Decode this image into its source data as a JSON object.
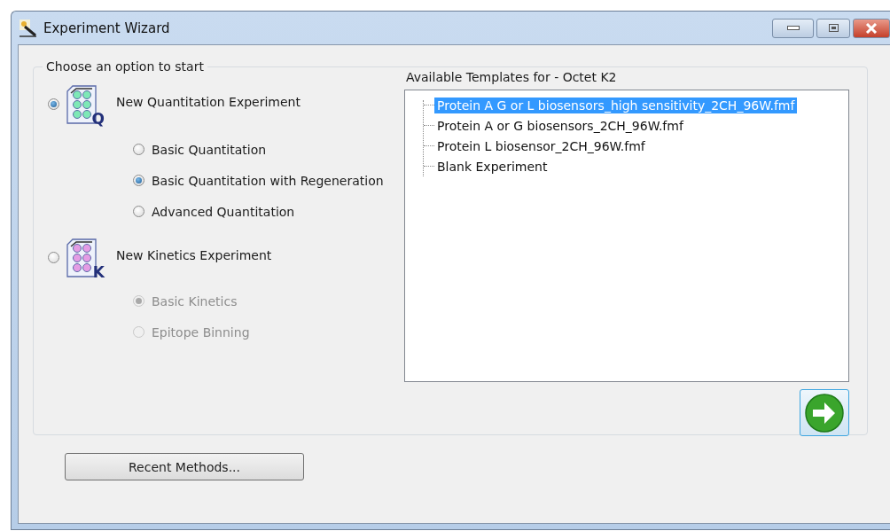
{
  "window": {
    "title": "Experiment Wizard"
  },
  "group": {
    "title": "Choose an option to start"
  },
  "experiments": [
    {
      "label": "New Quantitation Experiment",
      "selected": true,
      "icon_letter": "Q",
      "options": [
        {
          "label": "Basic Quantitation",
          "selected": false,
          "disabled": false
        },
        {
          "label": "Basic Quantitation with Regeneration",
          "selected": true,
          "disabled": false
        },
        {
          "label": "Advanced Quantitation",
          "selected": false,
          "disabled": false
        }
      ]
    },
    {
      "label": "New Kinetics Experiment",
      "selected": false,
      "icon_letter": "K",
      "options": [
        {
          "label": "Basic Kinetics",
          "selected": true,
          "disabled": true
        },
        {
          "label": "Epitope Binning",
          "selected": false,
          "disabled": true
        }
      ]
    }
  ],
  "templates": {
    "title": "Available Templates for - Octet K2",
    "items": [
      {
        "label": "Protein A G or L biosensors_high sensitivity_2CH_96W.fmf",
        "selected": true
      },
      {
        "label": "Protein A or G biosensors_2CH_96W.fmf",
        "selected": false
      },
      {
        "label": "Protein L biosensor_2CH_96W.fmf",
        "selected": false
      },
      {
        "label": "Blank Experiment",
        "selected": false
      }
    ]
  },
  "recent_button": "Recent Methods..."
}
